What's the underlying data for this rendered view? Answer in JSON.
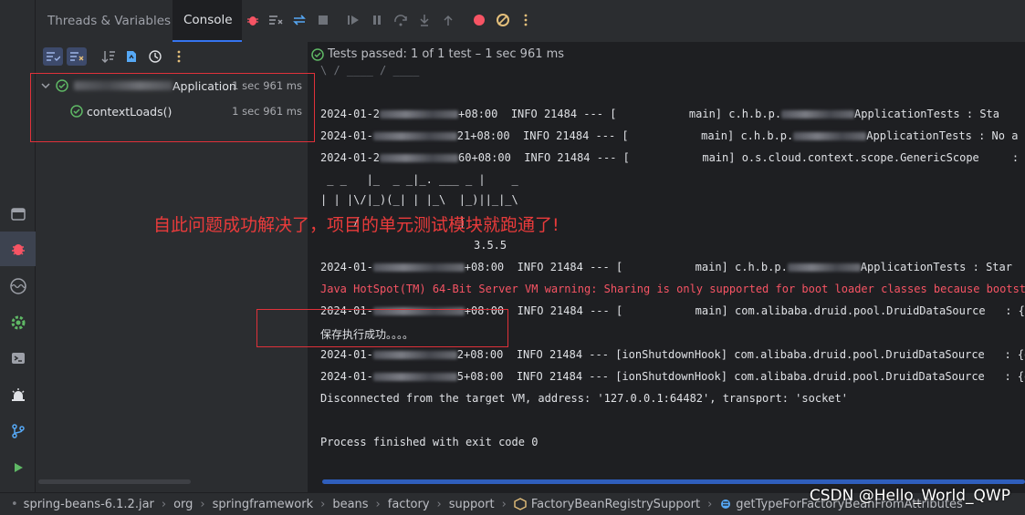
{
  "tabs": [
    {
      "label": "Threads & Variables"
    },
    {
      "label": "Console"
    }
  ],
  "tests_status": "Tests passed: 1 of 1 test – 1 sec 961 ms",
  "tree": {
    "root": {
      "label_suffix": "Application",
      "duration": "1 sec 961 ms"
    },
    "child": {
      "label": "contextLoads()",
      "duration": "1 sec 961 ms"
    }
  },
  "console": {
    "lines": {
      "l1": {
        "date": "2024-01-2",
        "mid": "+08:00  INFO 21484 --- [           main] c.h.b.p.",
        "tail": "ApplicationTests : Sta"
      },
      "l2": {
        "date": "2024-01-",
        "mid": "21+08:00  INFO 21484 --- [           main] c.h.b.p.",
        "tail": "ApplicationTests : No a"
      },
      "l3": {
        "date": "2024-01-2",
        "mid": "60+08:00  INFO 21484 --- [           main] o.s.cloud.context.scope.GenericScope     : Bean"
      },
      "l4": {
        "date": "2024-01-",
        "mid": "+08:00  INFO 21484 --- [           main] c.h.b.p.",
        "tail": "ApplicationTests : Star"
      },
      "warn": "Java HotSpot(TM) 64-Bit Server VM warning: Sharing is only supported for boot loader classes because bootstrap",
      "l5": {
        "date": "2024-01-",
        "mid": "+08:00  INFO 21484 --- [           main] com.alibaba.druid.pool.DruidDataSource   : {dat"
      },
      "saved": "保存执行成功。。。。",
      "l6": {
        "date": "2024-01-",
        "mid": "2+08:00  INFO 21484 --- [ionShutdownHook] com.alibaba.druid.pool.DruidDataSource   : {dat"
      },
      "l7": {
        "date": "2024-01-",
        "mid": "5+08:00  INFO 21484 --- [ionShutdownHook] com.alibaba.druid.pool.DruidDataSource   : {dat"
      },
      "disconnect": "Disconnected from the target VM, address: '127.0.0.1:64482', transport: 'socket'",
      "finished": "Process finished with exit code 0",
      "banner_1": " _ _   |_  _ _|_. ___ _ |    _",
      "banner_2": "| | |\\/|_)(_| | |_\\  |_)||_|_\\",
      "banner_3": "     /               |",
      "version": "3.5.5",
      "top_cut": "\\ / ____ / ____"
    }
  },
  "annotation_text": "自此问题成功解决了，项目的单元测试模块就跑通了!",
  "breadcrumbs": [
    "spring-beans-6.1.2.jar",
    "org",
    "springframework",
    "beans",
    "factory",
    "support",
    "FactoryBeanRegistrySupport",
    "getTypeForFactoryBeanFromAttributes"
  ],
  "watermark": "CSDN @Hello_World_QWP",
  "colors": {
    "accent": "#3574f0",
    "pass": "#5fb865",
    "warn": "#f75464",
    "annotation": "#e0313a"
  }
}
